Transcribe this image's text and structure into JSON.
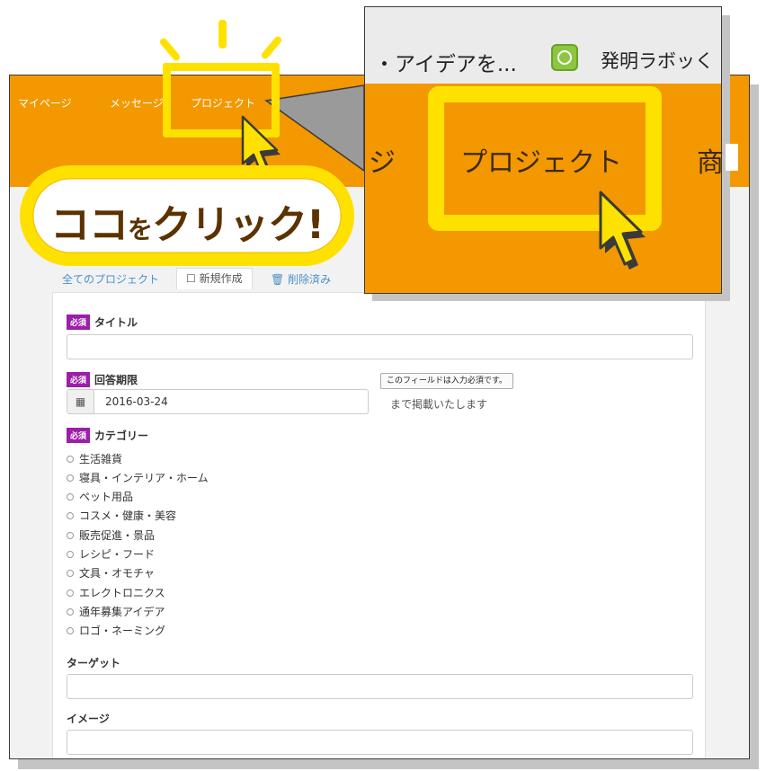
{
  "navbar": {
    "mypage": "マイページ",
    "message": "メッセージ",
    "project": "プロジェクト"
  },
  "tabs": {
    "all": "全てのプロジェクト",
    "new": "新規作成",
    "deleted": "削除済み"
  },
  "form": {
    "required_badge": "必須",
    "title_label": "タイトル",
    "deadline_label": "回答期限",
    "deadline_value": "2016-03-24",
    "tooltip": "このフィールドは入力必須です。",
    "made_text": "まで掲載いたします",
    "category_label": "カテゴリー",
    "categories": [
      "生活雑貨",
      "寝具・インテリア・ホーム",
      "ペット用品",
      "コスメ・健康・美容",
      "販売促進・景品",
      "レシピ・フード",
      "文具・オモチャ",
      "エレクトロニクス",
      "通年募集アイデア",
      "ロゴ・ネーミング"
    ],
    "target_label": "ターゲット",
    "image_label": "イメージ"
  },
  "zoom": {
    "browser_tab": "・アイデアを...",
    "app_name": "発明ラボッく",
    "nav_left": "ジ",
    "nav_project": "プロジェクト",
    "nav_right": "商"
  },
  "callout": {
    "part1": "ココ",
    "part2": "を",
    "part3": "クリック!"
  },
  "colors": {
    "orange": "#f39800",
    "highlight_yellow": "#ffe100",
    "badge_purple": "#9b1fa8",
    "callout_brown": "#5b3200"
  }
}
